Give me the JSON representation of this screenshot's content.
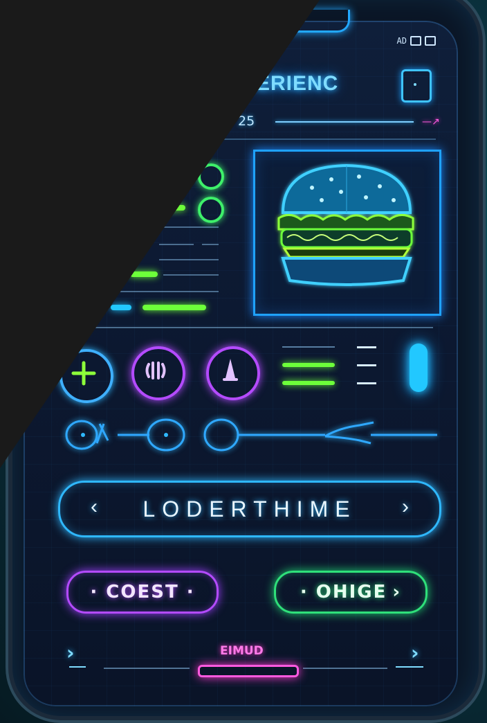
{
  "header": {
    "title": "ERIENC",
    "date": "25",
    "status_text": "AD"
  },
  "main": {
    "primary_button": "LODERTHIME",
    "chevron_left": "‹",
    "chevron_right": "›"
  },
  "actions": {
    "left_button": "· COEST ·",
    "right_button": "· OHIGE",
    "right_button_chevron": "›"
  },
  "bottom_nav": {
    "label": "EIMUD",
    "left_chevron": "›",
    "right_chevron": "›"
  },
  "colors": {
    "accent_blue": "#2fb8ff",
    "accent_purple": "#b44bff",
    "accent_green": "#2fe07a",
    "accent_pink": "#ff5ae0",
    "occluder": "#1a1a1a"
  }
}
